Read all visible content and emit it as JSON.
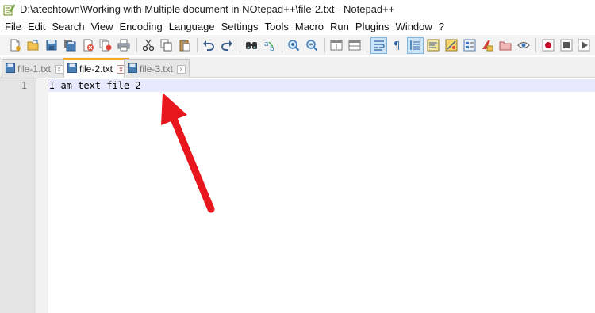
{
  "window": {
    "title": "D:\\atechtown\\Working with Multiple document in NOtepad++\\file-2.txt - Notepad++"
  },
  "menu": {
    "items": [
      "File",
      "Edit",
      "Search",
      "View",
      "Encoding",
      "Language",
      "Settings",
      "Tools",
      "Macro",
      "Run",
      "Plugins",
      "Window",
      "?"
    ]
  },
  "toolbar": {
    "buttons": [
      "new-file-icon",
      "open-file-icon",
      "save-icon",
      "save-all-icon",
      "close-icon",
      "close-all-icon",
      "print-icon",
      "cut-icon",
      "copy-icon",
      "paste-icon",
      "undo-icon",
      "redo-icon",
      "find-icon",
      "replace-icon",
      "zoom-in-icon",
      "zoom-out-icon",
      "sync-vertical-icon",
      "sync-horizontal-icon",
      "word-wrap-icon",
      "show-all-chars-icon",
      "indent-guide-icon",
      "language-icon",
      "doc-map-icon",
      "function-list-icon",
      "folder-workspace-icon",
      "monitoring-icon",
      "record-macro-icon",
      "stop-macro-icon",
      "play-macro-icon"
    ]
  },
  "tabs": [
    {
      "label": "file-1.txt",
      "close": "x",
      "state": "inactive"
    },
    {
      "label": "file-2.txt",
      "close": "x",
      "state": "active"
    },
    {
      "label": "file-3.txt",
      "close": "x",
      "state": "inactive"
    }
  ],
  "editor": {
    "line_number": "1",
    "text": "I am text file 2"
  },
  "colors": {
    "active_tab_accent": "#f5a623",
    "arrow": "#e8171d",
    "current_line": "#e8e8ff"
  }
}
